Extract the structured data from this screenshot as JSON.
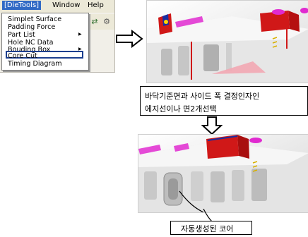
{
  "menubar": {
    "dietools": "[DieTools]",
    "window": "Window",
    "help": "Help"
  },
  "menu": {
    "items": [
      {
        "label": "Simplet Surface",
        "submenu": false
      },
      {
        "label": "Padding Force",
        "submenu": false
      },
      {
        "label": "Part List",
        "submenu": true
      },
      {
        "label": "Hole NC Data",
        "submenu": false
      },
      {
        "label": "Bouding Box",
        "submenu": true
      },
      {
        "label": "Core Cut",
        "submenu": false
      },
      {
        "label": "Timing Diagram",
        "submenu": false
      }
    ],
    "highlighted": "Core Cut"
  },
  "toolbar": {
    "icons": [
      "connector-icon",
      "gear-icon"
    ]
  },
  "caption": {
    "line1": "바닥기준면과 사이드 폭 결정인자인",
    "line2": "에지선이나 면2개선택"
  },
  "core_label": "자동생성된 코어",
  "colors": {
    "menu_selected": "#316ac5",
    "highlight_border": "#1c3f8f",
    "magenta": "#e02ad0",
    "red_block": "#d01818"
  }
}
